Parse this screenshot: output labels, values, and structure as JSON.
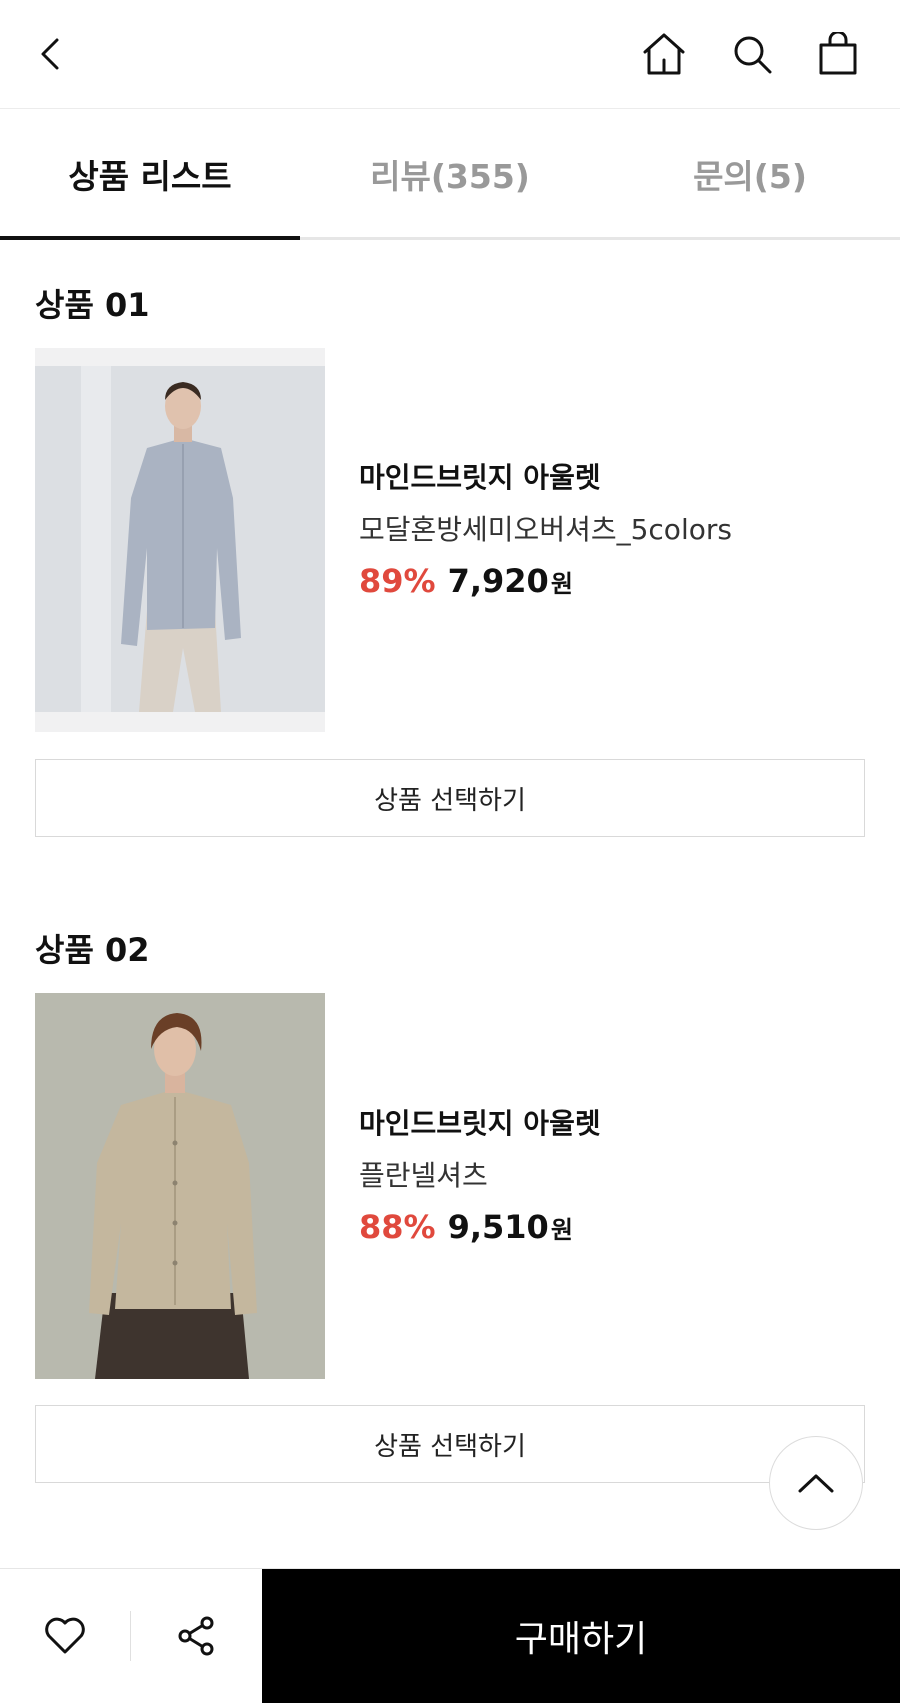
{
  "header": {
    "back_icon": "back-arrow-icon",
    "home_icon": "home-icon",
    "search_icon": "search-icon",
    "cart_icon": "shopping-bag-icon"
  },
  "tabs": [
    {
      "label": "상품 리스트",
      "active": true
    },
    {
      "label": "리뷰(355)",
      "active": false
    },
    {
      "label": "문의(5)",
      "active": false
    }
  ],
  "products": [
    {
      "section_title": "상품 01",
      "brand": "마인드브릿지 아울렛",
      "name": "모달혼방세미오버셔츠_5colors",
      "discount": "89%",
      "price": "7,920",
      "currency": "원",
      "button_label": "상품 선택하기",
      "image_colors": {
        "background": "#dcdfe3",
        "shirt": "#aab3c2",
        "pants": "#d9d1c7"
      }
    },
    {
      "section_title": "상품 02",
      "brand": "마인드브릿지 아울렛",
      "name": "플란넬셔츠",
      "discount": "88%",
      "price": "9,510",
      "currency": "원",
      "button_label": "상품 선택하기",
      "image_colors": {
        "background": "#b8b9ae",
        "shirt": "#c4b79e",
        "pants": "#3e342e"
      }
    }
  ],
  "bottom_bar": {
    "like_icon": "heart-icon",
    "share_icon": "share-icon",
    "buy_label": "구매하기"
  },
  "scroll_top_icon": "chevron-up-icon",
  "colors": {
    "accent_discount": "#e0493d",
    "buy_button": "#000000"
  }
}
